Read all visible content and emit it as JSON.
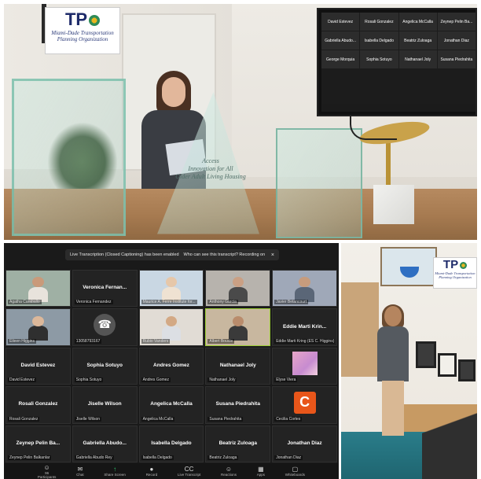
{
  "top_photo": {
    "sign": {
      "letters": "TP",
      "subtitle": "Miami-Dade Transportation Planning Organization"
    },
    "podium_engraving": [
      "Access",
      "Innovation for All",
      "Older Adult Living Housing"
    ],
    "tv_participants": [
      "David Estevez",
      "Rosali Gonzalez",
      "Angelica McCalla",
      "Zeynep Pelin Ba...",
      "Gabriella Abudo...",
      "Isabella Delgado",
      "Beatriz Zuloaga",
      "Jonathan Diaz",
      "George Morquia",
      "Sophia Sotuyo",
      "Nathanael Joly",
      "Susana Piedrahita"
    ]
  },
  "zoom": {
    "caption_banner": {
      "text": "Live Transcription (Closed Captioning) has been enabled",
      "link": "Who can see this transcript? Recording on",
      "close": "×"
    },
    "tiles": [
      {
        "kind": "video",
        "tag": "Agatha Caraballo",
        "skin": "#c99a7a",
        "shirt": "#e8e3dc",
        "bg": "#9fb0a4"
      },
      {
        "kind": "name",
        "name": "Veronica Fernan...",
        "tag": "Veronica Fernandez"
      },
      {
        "kind": "video",
        "tag": "Maurice A. Ferre Institute for...",
        "skin": "#e6c7a9",
        "shirt": "#efe2d2",
        "bg": "#c9d7e3"
      },
      {
        "kind": "video",
        "tag": "Anthony Garcia",
        "skin": "#caa084",
        "shirt": "#4a4a4a",
        "bg": "#b7b3ad"
      },
      {
        "kind": "video",
        "tag": "Javier Betancourt",
        "skin": "#c79c7d",
        "shirt": "#5a6677",
        "bg": "#9fa8b8"
      },
      {
        "kind": "video",
        "tag": "Eileen Higgins",
        "skin": "#dcb89a",
        "shirt": "#2f2f2f",
        "bg": "#8d9aa5"
      },
      {
        "kind": "phone",
        "tag": "13058793167"
      },
      {
        "kind": "video",
        "tag": "Rubio Vanders",
        "skin": "#d3a985",
        "shirt": "#dcdfe4",
        "bg": "#e1dcd5"
      },
      {
        "kind": "video",
        "tag": "Albert Boucle",
        "skin": "#b98c6c",
        "shirt": "#3a3a3a",
        "bg": "#c8b79f",
        "highlight": true
      },
      {
        "kind": "name",
        "name": "Eddie Marti Krin...",
        "tag": "Eddie Marti Kring (ES C. Higgins)"
      },
      {
        "kind": "name",
        "name": "David Estevez",
        "tag": "David Estevez"
      },
      {
        "kind": "name",
        "name": "Sophia Sotuyo",
        "tag": "Sophia Sotuyo"
      },
      {
        "kind": "name",
        "name": "Andres Gomez",
        "tag": "Andres Gomez"
      },
      {
        "kind": "name",
        "name": "Nathanael Joly",
        "tag": "Nathanael Joly"
      },
      {
        "kind": "pink",
        "tag": "Elyse Viera"
      },
      {
        "kind": "name",
        "name": "Rosali Gonzalez",
        "tag": "Rosali Gonzalez"
      },
      {
        "kind": "name",
        "name": "Jiselle Wilson",
        "tag": "Jiselle Wilson"
      },
      {
        "kind": "name",
        "name": "Angelica McCalla",
        "tag": "Angelica McCalla"
      },
      {
        "kind": "name",
        "name": "Susana Piedrahita",
        "tag": "Susana Piedrahita"
      },
      {
        "kind": "letter",
        "letter": "C",
        "tag": "Cecilia Cortes",
        "color": "#e8561a"
      },
      {
        "kind": "name",
        "name": "Zeynep Pelin Ba...",
        "tag": "Zeynep Pelin Balkanlar"
      },
      {
        "kind": "name",
        "name": "Gabriella Abudo...",
        "tag": "Gabriella Abudo Rey"
      },
      {
        "kind": "name",
        "name": "Isabella Delgado",
        "tag": "Isabella Delgado"
      },
      {
        "kind": "name",
        "name": "Beatriz Zuloaga",
        "tag": "Beatriz Zuloaga"
      },
      {
        "kind": "name",
        "name": "Jonathan Diaz",
        "tag": "Jonathan Diaz"
      }
    ],
    "toolbar": [
      {
        "icon": "participants-icon",
        "glyph": "☺",
        "label": "Participants",
        "count": "96"
      },
      {
        "icon": "chat-icon",
        "glyph": "✉",
        "label": "Chat"
      },
      {
        "icon": "share-screen-icon",
        "glyph": "↑",
        "label": "Share Screen",
        "green": true
      },
      {
        "icon": "record-icon",
        "glyph": "●",
        "label": "Record"
      },
      {
        "icon": "live-transcript-icon",
        "glyph": "CC",
        "label": "Live Transcript"
      },
      {
        "icon": "reactions-icon",
        "glyph": "☺",
        "label": "Reactions"
      },
      {
        "icon": "apps-icon",
        "glyph": "▦",
        "label": "Apps"
      },
      {
        "icon": "whiteboards-icon",
        "glyph": "▢",
        "label": "Whiteboards"
      }
    ]
  },
  "office_photo": {
    "sign": {
      "letters": "TP",
      "subtitle": "Miami-Dade Transportation Planning Organization"
    }
  }
}
